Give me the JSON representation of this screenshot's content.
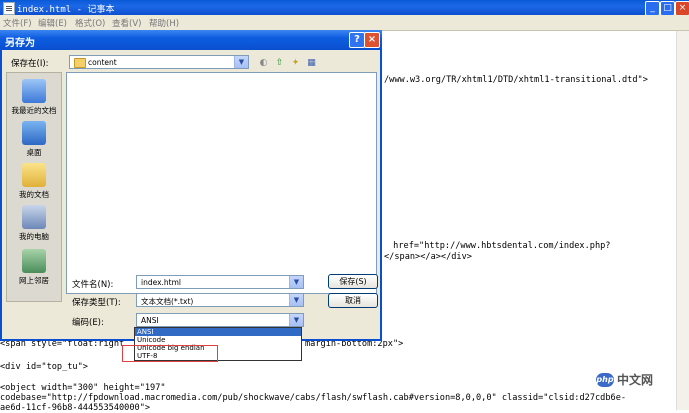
{
  "notepad": {
    "title": "index.html - 记事本",
    "menu": [
      "文件(F)",
      "编辑(E)",
      "格式(O)",
      "查看(V)",
      "帮助(H)"
    ],
    "controls": {
      "minimize": "_",
      "maximize": "□",
      "close": "×"
    },
    "code_lines": [
      "/www.w3.org/TR/xhtml1/DTD/xhtml1-transitional.dtd\">",
      " href=\"http://www.hbtsdental.com/index.php?",
      "</span></a></div>",
      "<span style=\"float:right",
      "margin-bottom:2px\">",
      "<div id=\"top_tu\">",
      "<object width=\"300\" height=\"197\"",
      "codebase=\"http://fpdownload.macromedia.com/pub/shockwave/cabs/flash/swflash.cab#version=8,0,0,0\" classid=\"clsid:d27cdb6e-",
      "ae6d-11cf-96b8-444553540000\">"
    ]
  },
  "dialog": {
    "title": "另存为",
    "help": "?",
    "close": "×",
    "save_in_label": "保存在(I):",
    "save_in_value": "content",
    "places": [
      "我最近的文档",
      "桌面",
      "我的文档",
      "我的电脑",
      "网上邻居"
    ],
    "filename_label": "文件名(N):",
    "filename_value": "index.html",
    "savetype_label": "保存类型(T):",
    "savetype_value": "文本文档(*.txt)",
    "encoding_label": "编码(E):",
    "encoding_value": "ANSI",
    "encoding_options": [
      "ANSI",
      "Unicode",
      "Unicode big endian",
      "UTF-8"
    ],
    "save_button": "保存(S)",
    "cancel_button": "取消"
  },
  "watermark": {
    "logo": "php",
    "text": "中文网"
  }
}
